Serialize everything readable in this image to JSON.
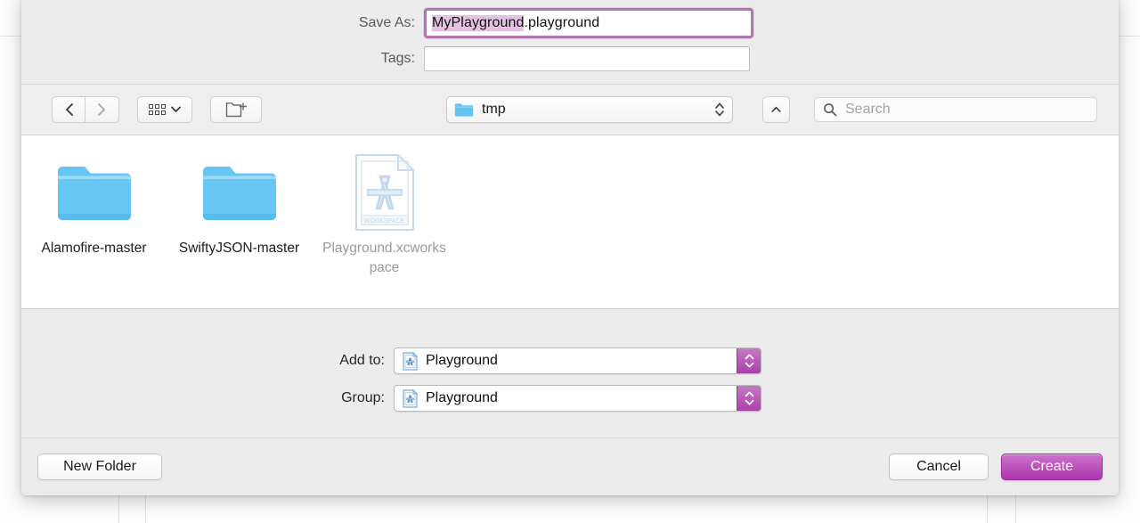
{
  "dialog": {
    "save_as_label": "Save As:",
    "filename_selected": "MyPlayground",
    "filename_extension": ".playground",
    "tags_label": "Tags:",
    "tags_value": ""
  },
  "toolbar": {
    "back_icon": "chevron-left-icon",
    "forward_icon": "chevron-right-icon",
    "view_icon": "icon-view-grid-icon",
    "view_chevron_icon": "chevron-down-icon",
    "new_folder_icon": "new-folder-icon",
    "path_label": "tmp",
    "path_folder_icon": "folder-icon",
    "path_stepper_icon": "up-down-arrows-icon",
    "up_icon": "chevron-up-icon",
    "search_icon": "search-icon",
    "search_placeholder": "Search",
    "search_value": ""
  },
  "browser": {
    "items": [
      {
        "name": "Alamofire-master",
        "type": "folder",
        "icon": "folder-icon",
        "dimmed": false
      },
      {
        "name": "SwiftyJSON-master",
        "type": "folder",
        "icon": "folder-icon",
        "dimmed": false
      },
      {
        "name": "Playground.xcworkspace",
        "type": "workspace",
        "icon": "xcode-workspace-icon",
        "icon_caption": "WORKSPACE",
        "dimmed": true
      }
    ]
  },
  "accessory": {
    "rows": [
      {
        "label": "Add to:",
        "value": "Playground",
        "icon": "xcode-workspace-icon",
        "stepper_icon": "up-down-arrows-icon"
      },
      {
        "label": "Group:",
        "value": "Playground",
        "icon": "xcode-workspace-icon",
        "stepper_icon": "up-down-arrows-icon"
      }
    ]
  },
  "footer": {
    "new_folder_label": "New Folder",
    "cancel_label": "Cancel",
    "create_label": "Create"
  },
  "colors": {
    "accent": "#ab35ab",
    "focus_ring": "#b077b0",
    "selection": "#e4c2e4",
    "folder_blue": "#6ec7f5",
    "sheet_bg": "#ececec"
  }
}
